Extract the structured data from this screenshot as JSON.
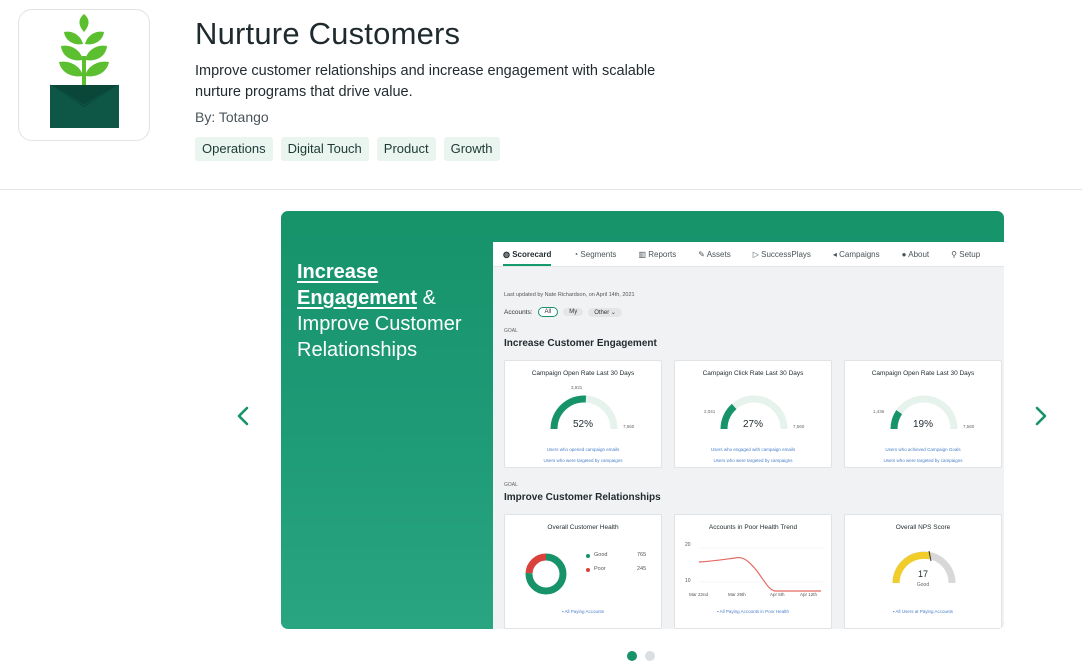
{
  "app": {
    "title": "Nurture Customers",
    "description": "Improve customer relationships and increase engagement with scalable nurture programs that drive value.",
    "author": "By: Totango",
    "tags": [
      "Operations",
      "Digital Touch",
      "Product",
      "Growth"
    ]
  },
  "colors": {
    "accent": "#17936a",
    "dark_green": "#0e5646",
    "tag_bg": "#ebf5f0"
  },
  "carousel": {
    "prev_icon": "chevron-left-icon",
    "next_icon": "chevron-right-icon",
    "active_dot": 1,
    "dot_count": 2,
    "slide": {
      "headline_part1": "Increase",
      "headline_part2": "Engagement",
      "headline_part3": " &",
      "headline_part4": "Improve Customer Relationships",
      "tabs": [
        "Scorecard",
        "Segments",
        "Reports",
        "Assets",
        "SuccessPlays",
        "Campaigns",
        "About",
        "Setup"
      ],
      "last_updated": "Last updated by Nate Richardson, on April 14th, 2021",
      "accounts_label": "Accounts:",
      "filters": [
        "All",
        "My",
        "Other"
      ],
      "goal_label": "GOAL",
      "section1_title": "Increase Customer Engagement",
      "section2_title": "Improve Customer Relationships",
      "gauges": [
        {
          "title": "Campaign Open Rate Last 30 Days",
          "value": "52%",
          "fraction": 0.52,
          "top": "3,931",
          "max": "7,560",
          "link1": "Users who opened campaign emails",
          "link2": "Users who were targeted by campaigns"
        },
        {
          "title": "Campaign Click Rate Last 30 Days",
          "value": "27%",
          "fraction": 0.27,
          "top": "2,041",
          "max": "7,560",
          "link1": "Users who engaged with campaign emails",
          "link2": "Users who were targeted by campaigns"
        },
        {
          "title": "Campaign Open Rate Last 30 Days",
          "value": "19%",
          "fraction": 0.19,
          "top": "1,436",
          "max": "7,560",
          "link1": "Users who achieved Campaign Goals",
          "link2": "Users who were targeted by campaigns"
        }
      ],
      "health": {
        "title": "Overall Customer Health",
        "good_label": "Good",
        "good_value": "765",
        "poor_label": "Poor",
        "poor_value": "245",
        "good_count": 765,
        "poor_count": 245,
        "link": "All Paying Accounts"
      },
      "trend": {
        "title": "Accounts in Poor Health Trend",
        "y_top": "20",
        "y_bottom": "10",
        "x_labels": [
          "Mar 22nd",
          "Mar 29th",
          "Apr 5th",
          "Apr 12th"
        ],
        "link": "All Paying Accounts in Poor Health"
      },
      "nps": {
        "title": "Overall NPS Score",
        "value": "17",
        "label": "Good",
        "link": "All Users at Paying Accounts"
      }
    }
  }
}
